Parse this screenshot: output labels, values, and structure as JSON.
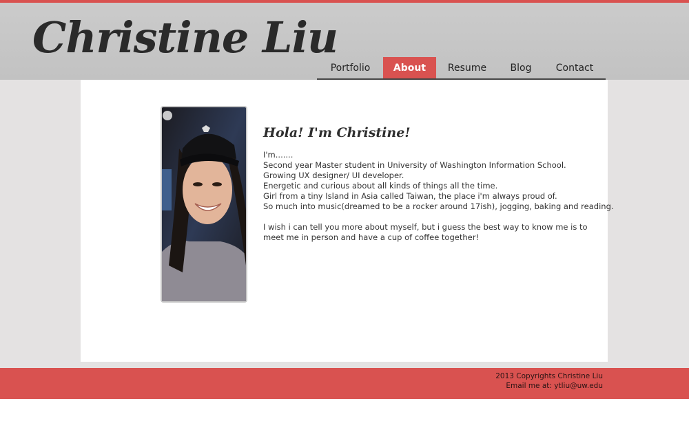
{
  "header": {
    "logo": "Christine Liu"
  },
  "nav": {
    "items": [
      {
        "label": "Portfolio",
        "active": false
      },
      {
        "label": "About",
        "active": true
      },
      {
        "label": "Resume",
        "active": false
      },
      {
        "label": "Blog",
        "active": false
      },
      {
        "label": "Contact",
        "active": false
      }
    ]
  },
  "colors": {
    "accent": "#d95250",
    "background": "#e4e2e2",
    "header": "#c6c6c6",
    "card": "#ffffff"
  },
  "about": {
    "heading": "Hola! I'm Christine!",
    "lines": [
      "I'm.......",
      "Second year Master student in University of Washington Information School.",
      "Growing UX designer/ UI developer.",
      "Energetic and curious about all kinds of things all the time.",
      "Girl from a tiny Island in Asia called Taiwan, the place i'm always proud of.",
      "So much into music(dreamed to be a rocker around 17ish), jogging, baking and reading."
    ],
    "closing": "I wish i can tell you more about myself, but i guess the best way to know me is to meet me in person and have a cup of coffee together!"
  },
  "footer": {
    "copyright": "2013 Copyrights Christine Liu",
    "email": "Email me at: ytliu@uw.edu"
  }
}
